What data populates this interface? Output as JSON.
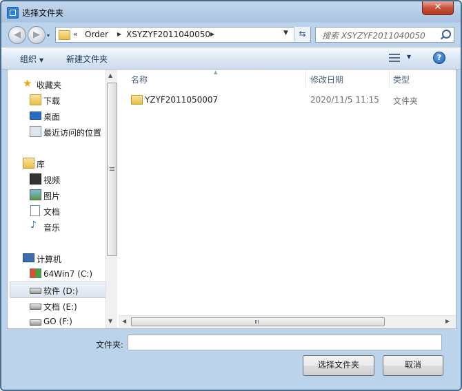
{
  "window": {
    "title": "选择文件夹",
    "close_glyph": "✕"
  },
  "nav": {
    "back_glyph": "◀",
    "forward_glyph": "▶",
    "dropdown_glyph": "▾",
    "chevron": "«",
    "separator": "▶",
    "breadcrumb": [
      "Order",
      "XSYZYF2011040050"
    ],
    "address_dropdown_glyph": "▼",
    "refresh_glyph": "⇆",
    "search_placeholder": "搜索 XSYZYF2011040050"
  },
  "toolbar": {
    "organize_label": "组织",
    "new_folder_label": "新建文件夹",
    "dropdown_glyph": "▼",
    "help_glyph": "?"
  },
  "sidebar": {
    "favorites": {
      "label": "收藏夹",
      "items": [
        {
          "label": "下载"
        },
        {
          "label": "桌面"
        },
        {
          "label": "最近访问的位置"
        }
      ]
    },
    "libraries": {
      "label": "库",
      "items": [
        {
          "label": "视频"
        },
        {
          "label": "图片"
        },
        {
          "label": "文档"
        },
        {
          "label": "音乐"
        }
      ]
    },
    "computer": {
      "label": "计算机",
      "items": [
        {
          "label": "64Win7  (C:)"
        },
        {
          "label": "软件 (D:)",
          "selected": true
        },
        {
          "label": "文档 (E:)"
        },
        {
          "label": "GO (F:)"
        }
      ]
    }
  },
  "columns": {
    "name": "名称",
    "date": "修改日期",
    "type": "类型"
  },
  "files": [
    {
      "name": "YZYF2011050007",
      "modified": "2020/11/5 11:15",
      "type": "文件夹"
    }
  ],
  "scroll": {
    "up": "▲",
    "down": "▼",
    "left": "◀",
    "right": "▶"
  },
  "footer": {
    "folder_label": "文件夹:",
    "folder_value": "",
    "select_button": "选择文件夹",
    "cancel_button": "取消"
  },
  "colors": {
    "window_border": "#4a6a8c",
    "close_red": "#c75039",
    "toolbar_text": "#1e395b",
    "selection_bg": "#dbe4ef"
  }
}
